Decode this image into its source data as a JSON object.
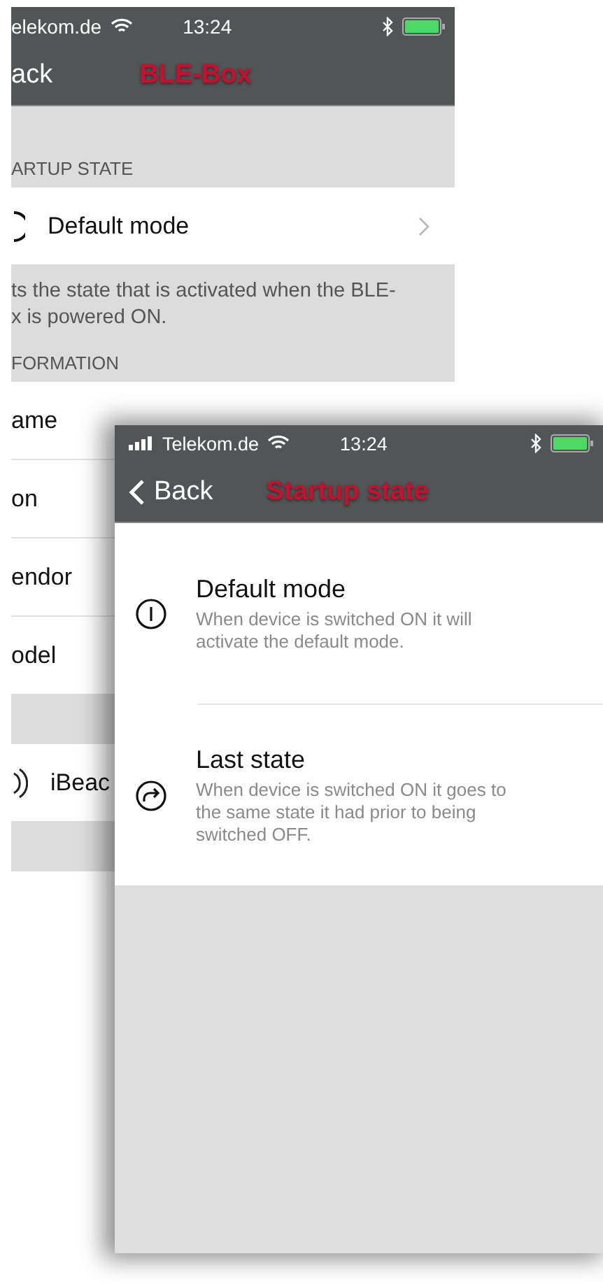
{
  "back_screen": {
    "status_bar": {
      "carrier": "elekom.de",
      "time": "13:24"
    },
    "nav": {
      "back": "ack",
      "title": "BLE-Box"
    },
    "sections": [
      {
        "header": "ARTUP STATE",
        "rows": [
          {
            "kind": "icon",
            "label": "Default mode",
            "chevron": true
          }
        ],
        "footer": [
          "ts the state that is activated when the BLE-",
          "x is powered ON."
        ]
      },
      {
        "header": "FORMATION",
        "rows": [
          {
            "kind": "plain",
            "label": "ame"
          },
          {
            "kind": "plain",
            "label": "on"
          },
          {
            "kind": "plain",
            "label": "endor"
          },
          {
            "kind": "plain",
            "label": "odel"
          }
        ]
      },
      {
        "rows": [
          {
            "kind": "beacon",
            "label": "iBeac"
          }
        ]
      }
    ]
  },
  "front_screen": {
    "status_bar": {
      "carrier": "Telekom.de",
      "time": "13:24"
    },
    "nav": {
      "back": "Back",
      "title": "Startup state"
    },
    "options": [
      {
        "kind": "power",
        "title": "Default mode",
        "description": "When device is switched ON it will activate the default mode."
      },
      {
        "kind": "redo",
        "title": "Last state",
        "description": "When device is switched ON it goes to the same state it had prior to being switched OFF."
      }
    ]
  }
}
